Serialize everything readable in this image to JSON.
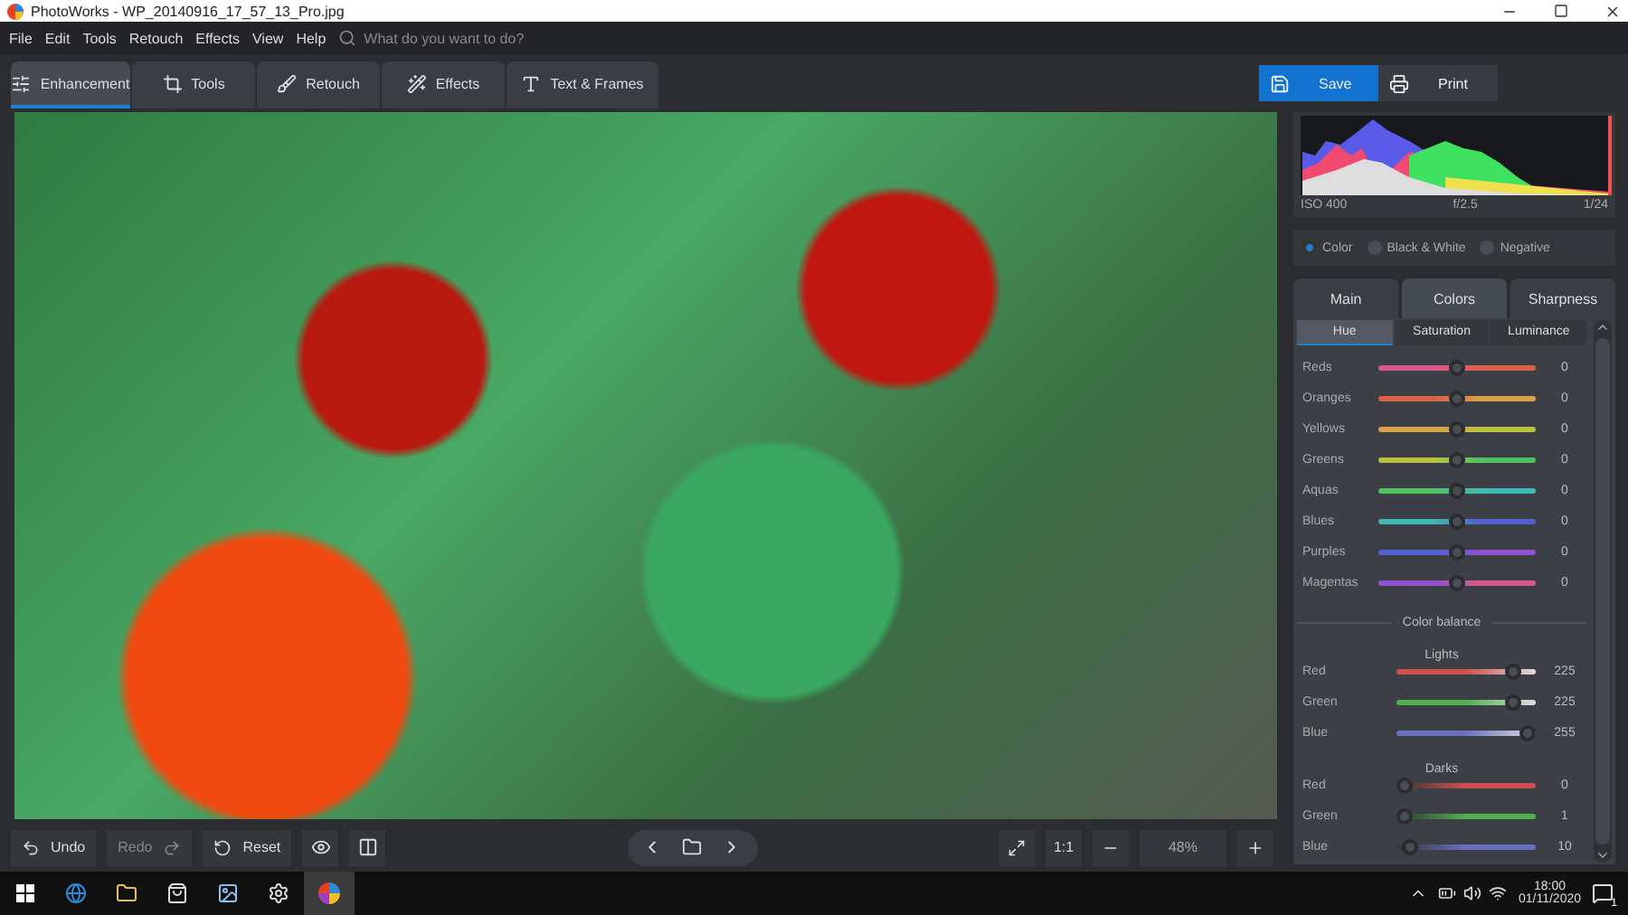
{
  "window": {
    "title": "PhotoWorks - WP_20140916_17_57_13_Pro.jpg"
  },
  "menu": [
    "File",
    "Edit",
    "Tools",
    "Retouch",
    "Effects",
    "View",
    "Help"
  ],
  "search": {
    "placeholder": "What do you want to do?"
  },
  "modes": [
    {
      "label": "Enhancement",
      "selected": true,
      "kind": "sliders"
    },
    {
      "label": "Tools",
      "selected": false,
      "kind": "crop"
    },
    {
      "label": "Retouch",
      "selected": false,
      "kind": "brush"
    },
    {
      "label": "Effects",
      "selected": false,
      "kind": "wand"
    },
    {
      "label": "Text & Frames",
      "selected": false,
      "kind": "text"
    }
  ],
  "actions": [
    {
      "label": "Save",
      "kind": "save"
    },
    {
      "label": "Print",
      "kind": "print"
    }
  ],
  "histogram": {
    "iso": "ISO 400",
    "aperture": "f/2.5",
    "shutter": "1/24"
  },
  "color_modes": [
    {
      "label": "Color",
      "selected": true
    },
    {
      "label": "Black & White",
      "selected": false
    },
    {
      "label": "Negative",
      "selected": false
    }
  ],
  "tabs": [
    {
      "label": "Main",
      "selected": false
    },
    {
      "label": "Colors",
      "selected": true
    },
    {
      "label": "Sharpness",
      "selected": false
    }
  ],
  "subtabs": [
    {
      "label": "Hue",
      "selected": true
    },
    {
      "label": "Saturation",
      "selected": false
    },
    {
      "label": "Luminance",
      "selected": false
    }
  ],
  "hue_sliders": [
    {
      "name": "Reds",
      "value": "0",
      "level": 0.5,
      "color": "#d85a8a"
    },
    {
      "name": "Oranges",
      "value": "0",
      "level": 0.5,
      "color": "#d8604a"
    },
    {
      "name": "Yellows",
      "value": "0",
      "level": 0.5,
      "color": "#d8a048"
    },
    {
      "name": "Greens",
      "value": "0",
      "level": 0.5,
      "color": "#b8c040"
    },
    {
      "name": "Aquas",
      "value": "0",
      "level": 0.5,
      "color": "#50c060"
    },
    {
      "name": "Blues",
      "value": "0",
      "level": 0.5,
      "color": "#40b8b0"
    },
    {
      "name": "Purples",
      "value": "0",
      "level": 0.5,
      "color": "#5060d0"
    },
    {
      "name": "Magentas",
      "value": "0",
      "level": 0.5,
      "color": "#9050d0"
    }
  ],
  "color_balance": {
    "title": "Color balance",
    "groups": [
      {
        "title": "Lights",
        "sliders": [
          {
            "name": "Red",
            "value": "225",
            "level": 0.88,
            "color": "#d05050"
          },
          {
            "name": "Green",
            "value": "225",
            "level": 0.88,
            "color": "#50b050"
          },
          {
            "name": "Blue",
            "value": "255",
            "level": 1,
            "color": "#6a70c0"
          }
        ]
      },
      {
        "title": "Darks",
        "sliders": [
          {
            "name": "Red",
            "value": "0",
            "level": 0,
            "color": "#d05050"
          },
          {
            "name": "Green",
            "value": "1",
            "level": 0,
            "color": "#50b050"
          },
          {
            "name": "Blue",
            "value": "10",
            "level": 0.04,
            "color": "#6a70c0"
          }
        ]
      }
    ]
  },
  "bottom_bar": {
    "undo": "Undo",
    "redo": "Redo",
    "reset": "Reset",
    "zoom_fit": "1:1",
    "zoom": "48%"
  },
  "taskbar": {
    "time": "18:00",
    "date": "01/11/2020",
    "notifications": "1"
  }
}
